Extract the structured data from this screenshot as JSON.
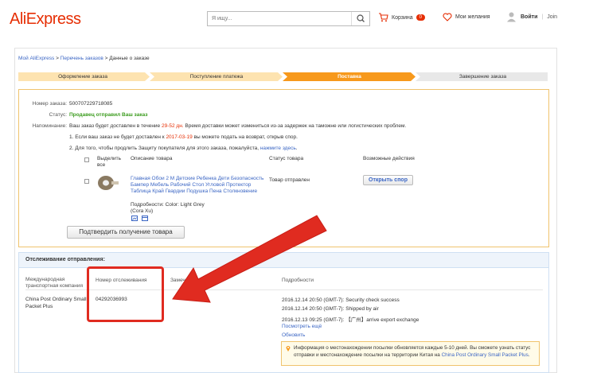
{
  "header": {
    "logo": "AliExpress",
    "search_placeholder": "Я ищу...",
    "cart_label": "Корзина",
    "cart_count": "0",
    "wishlist_label": "Мои желания",
    "login": "Войти",
    "join": "Join",
    "brand_color": "#e62e04"
  },
  "breadcrumb": {
    "item1": "Мой AliExpress",
    "item2": "Перечень заказов",
    "current": "Данные о заказе",
    "separator": ">"
  },
  "progress": {
    "steps": [
      "Оформление заказа",
      "Поступление платежа",
      "Поставка",
      "Завершение заказа"
    ],
    "active_index": 2
  },
  "order": {
    "number_label": "Номер заказа:",
    "number": "500707229718085",
    "status_label": "Статус:",
    "status": "Продавец отправил Ваш заказ",
    "reminder_label": "Напоминание:",
    "reminder_pre": "Ваш заказ будет доставлен в течение",
    "reminder_days": "29-52 дн.",
    "reminder_post": "Время доставки может измениться из-за задержек на таможне или логистических проблем.",
    "note1_pre": "1. Если ваш заказ не будет доставлен к",
    "note1_date": "2017-03-19",
    "note1_post": "вы можете подать на возврат, открыв спор.",
    "note2_pre": "2. Для того, чтобы продлить Защиту покупателя для этого заказа, пожалуйста,",
    "note2_link": "нажмите здесь",
    "note2_post": ".",
    "col_select": "Выделить все",
    "col_desc": "Описание товара",
    "col_status": "Статус товара",
    "col_actions": "Возможные действия",
    "product_title": "Главная Обои 2 М Детские Ребенка Дети Безопасность Бампер Мебель Рабочий Стол Угловой Протектор Таблица Край Гвардии Подушка Пена Столкновение",
    "product_props": "Подробности: Color: Light Grey",
    "product_seller": "(Cora Xu)",
    "product_status": "Товар отправлен",
    "dispute_button": "Открыть спор",
    "confirm_button": "Подтвердить получение товара"
  },
  "tracking": {
    "title": "Отслеживание отправления:",
    "col_carrier": "Международная транспортная компания",
    "col_number": "Номер отслеживания",
    "col_notes": "Замеча",
    "col_details": "Подробности",
    "carrier": "China Post Ordinary Small Packet Plus",
    "number": "04292036993",
    "events": [
      "2016.12.14 20:50 (GMT-7): Security check success",
      "2016.12.14 20:50 (GMT-7): Shipped by air",
      "2016.12.13 09:25 (GMT-7): 【广州】arrive export exchange"
    ],
    "show_more": "Посмотреть ещё",
    "refresh": "Обновить",
    "notice_pre": "Информация о местонахождении посылки обновляется каждые 5-10 дней. Вы сможете узнать статус отправки и местонахождение посылки на территории Китая на",
    "notice_link": "China Post Ordinary Small Packet Plus",
    "notice_post": "."
  }
}
